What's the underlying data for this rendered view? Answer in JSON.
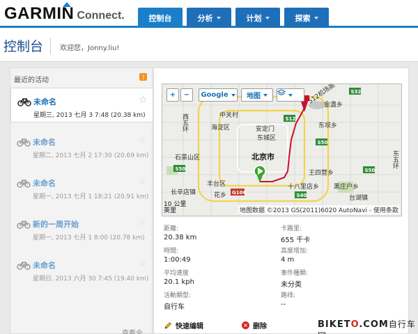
{
  "header": {
    "logo_main": "GARMIN",
    "logo_sub": "Connect.",
    "tabs": [
      {
        "label": "控制台",
        "active": true
      },
      {
        "label": "分析",
        "active": false
      },
      {
        "label": "计划",
        "active": false
      },
      {
        "label": "探索",
        "active": false
      }
    ]
  },
  "page": {
    "title": "控制台",
    "welcome": "欢迎您，Jonny.liu!"
  },
  "activities": {
    "title": "最近的活动",
    "see_all": "查看全部...",
    "items": [
      {
        "name": "未命名",
        "meta": "星期三, 2013 七月 3 7:48 (20.38 km)",
        "selected": true
      },
      {
        "name": "未命名",
        "meta": "星期二, 2013 七月 2 17:30 (20.69 km)",
        "selected": false
      },
      {
        "name": "未命名",
        "meta": "星期一, 2013 七月 1 18:21 (20.91 km)",
        "selected": false
      },
      {
        "name": "新的一周开始",
        "meta": "星期一, 2013 七月 1 8:00 (20.78 km)",
        "selected": false
      },
      {
        "name": "未命名",
        "meta": "星期日, 2013 六月 30 7:45 (19.40 km)",
        "selected": false
      }
    ]
  },
  "map": {
    "zoom_in": "+",
    "zoom_out": "−",
    "provider": "Google",
    "type": "地图",
    "attribution": "地图数据 ©2013 GS(2011)6020 AutoNavi - 使用条款",
    "scale": "10 公里",
    "scale_unit": "英里",
    "labels": [
      "中关村",
      "海淀区",
      "安定门",
      "东城区",
      "石景山区",
      "北京市",
      "丰台区",
      "花乡",
      "王四营乡",
      "十八里店乡",
      "黑庄户乡",
      "台湖镇",
      "长辛店镇",
      "东坝乡",
      "金盏乡",
      "西五环",
      "东五环",
      "S12",
      "S32",
      "S50",
      "G106",
      "S40",
      "512机场高"
    ]
  },
  "stats": [
    {
      "label": "距離:",
      "value": "20.38 km"
    },
    {
      "label": "卡路里:",
      "value": "655 千卡"
    },
    {
      "label": "時間:",
      "value": "1:00:49"
    },
    {
      "label": "高度增加:",
      "value": "4 m"
    },
    {
      "label": "平均速度",
      "value": "20.1 kph"
    },
    {
      "label": "事件種類:",
      "value": "未分类"
    },
    {
      "label": "活動類型:",
      "value": "自行车"
    },
    {
      "label": "路线:",
      "value": "--"
    }
  ],
  "actions": {
    "edit": "快速编辑",
    "delete": "删除"
  },
  "watermark": {
    "prefix": "BIKET",
    "o": "O",
    "suffix": ".COM",
    "cn": "自行车网"
  },
  "colors": {
    "brand_blue": "#1a7fc8",
    "tab_blue": "#1f6fb8",
    "link_blue": "#1a73b8",
    "route_red": "#c8102e",
    "start_green": "#3aa62a"
  }
}
